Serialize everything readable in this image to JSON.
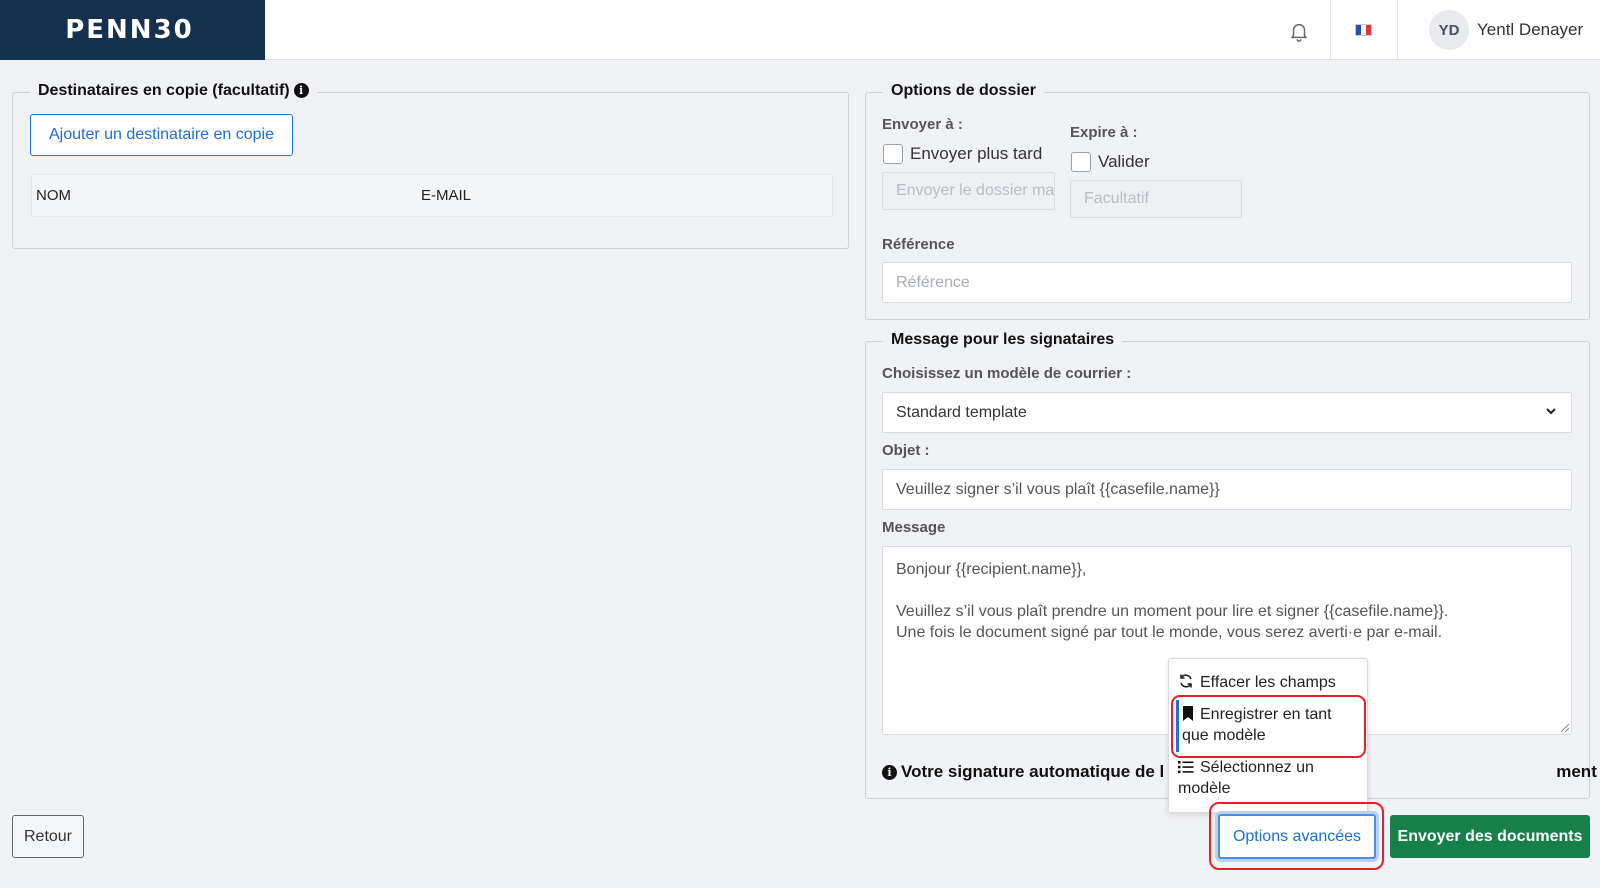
{
  "header": {
    "logo": "PENN30",
    "user_initials": "YD",
    "user_name": "Yentl Denayer",
    "language_flag": "flag-fr-icon"
  },
  "cc": {
    "legend": "Destinataires en copie (facultatif)",
    "add_button": "Ajouter un destinataire en copie",
    "columns": [
      "NOM",
      "E-MAIL"
    ]
  },
  "case_options": {
    "legend": "Options de dossier",
    "send_at_label": "Envoyer à :",
    "send_later_label": "Envoyer plus tard",
    "send_at_placeholder": "Envoyer le dossier maintenant",
    "expire_label": "Expire à :",
    "validate_label": "Valider",
    "expire_placeholder": "Facultatif",
    "reference_label": "Référence",
    "reference_placeholder": "Référence"
  },
  "message": {
    "legend": "Message pour les signataires",
    "template_label": "Choisissez un modèle de courrier :",
    "template_value": "Standard template",
    "subject_label": "Objet :",
    "subject_value": "Veuillez signer s’il vous plaît {{casefile.name}}",
    "body_label": "Message",
    "body_line1": "Bonjour {{recipient.name}},",
    "body_line2": "Veuillez s’il vous plaît prendre un moment pour lire et signer {{casefile.name}}.",
    "body_line3": "Une fois le document signé par tout le monde, vous serez averti·e par e-mail.",
    "signature_note_start": "Votre signature automatique de l",
    "signature_note_end": "ment ajoutée."
  },
  "menu": {
    "items": [
      {
        "label": "Effacer les champs",
        "icon": "refresh-icon"
      },
      {
        "label": "Enregistrer en tant que modèle",
        "icon": "bookmark-icon"
      },
      {
        "label": "Sélectionnez un modèle",
        "icon": "list-icon"
      }
    ]
  },
  "footer": {
    "back_label": "Retour",
    "advanced_label": "Options avancées",
    "send_label": "Envoyer des documents"
  },
  "colors": {
    "brand_navy": "#16314d",
    "primary_blue": "#1f6ed0",
    "send_green": "#16804a",
    "highlight_red": "#e0202b"
  }
}
